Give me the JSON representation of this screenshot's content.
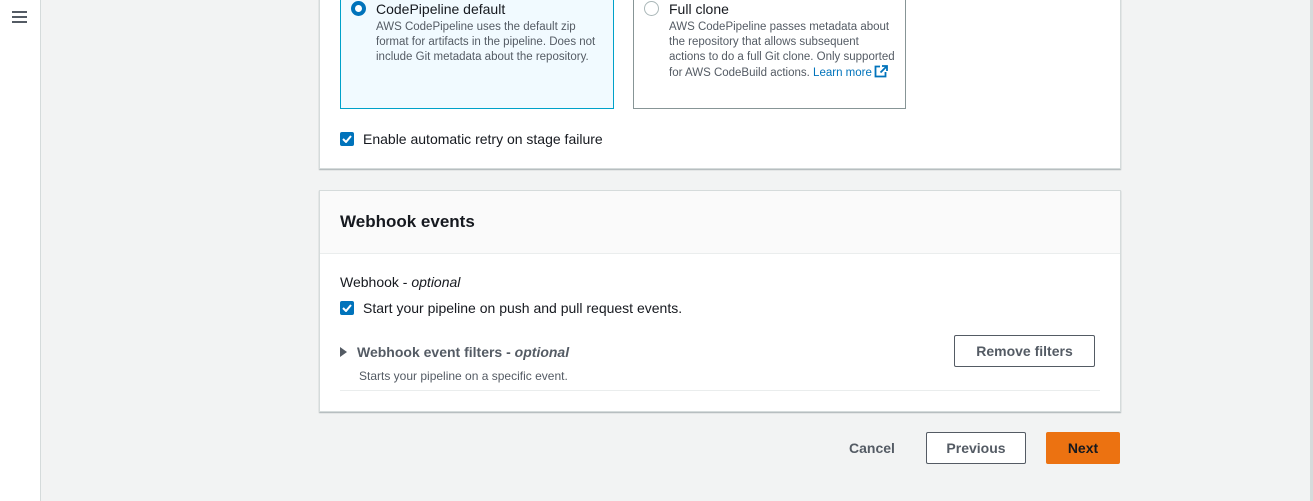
{
  "artifact_format": {
    "options": [
      {
        "title": "CodePipeline default",
        "description": "AWS CodePipeline uses the default zip format for artifacts in the pipeline. Does not include Git metadata about the repository.",
        "selected": true
      },
      {
        "title": "Full clone",
        "description": "AWS CodePipeline passes metadata about the repository that allows subsequent actions to do a full Git clone. Only supported for AWS CodeBuild actions.",
        "link_text": "Learn more",
        "selected": false
      }
    ]
  },
  "retry": {
    "label": "Enable automatic retry on stage failure",
    "checked": true
  },
  "webhook_events": {
    "heading": "Webhook events",
    "field_label": "Webhook",
    "field_optional": "optional",
    "checkbox_label": "Start your pipeline on push and pull request events.",
    "checkbox_checked": true,
    "filters_title": "Webhook event filters",
    "filters_optional": "optional",
    "filters_description": "Starts your pipeline on a specific event.",
    "remove_filters_label": "Remove filters"
  },
  "footer": {
    "cancel_label": "Cancel",
    "previous_label": "Previous",
    "next_label": "Next"
  },
  "colors": {
    "primary_button": "#ec7211",
    "link": "#0073bb",
    "selected_card_bg": "#f1faff",
    "selected_card_border": "#00a1c9"
  },
  "icons": {
    "menu": "hamburger-menu-icon",
    "external": "external-link-icon",
    "expand": "caret-right-icon",
    "check": "checkmark-icon"
  }
}
